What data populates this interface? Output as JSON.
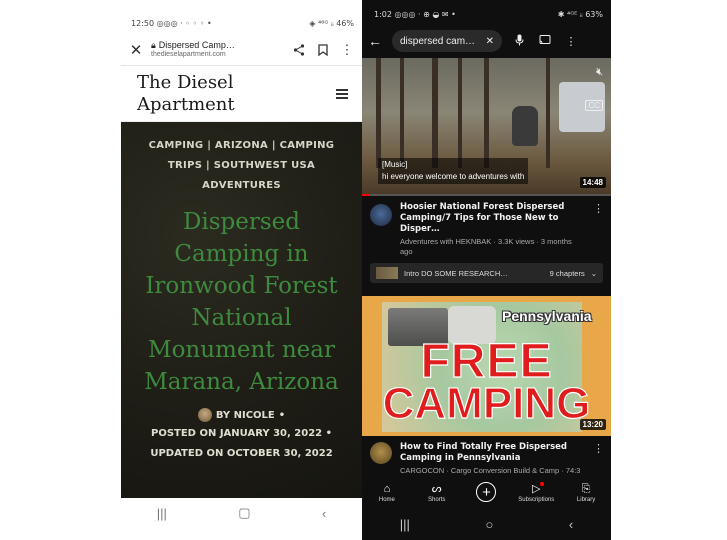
{
  "left_phone": {
    "status": {
      "time": "12:50",
      "icons": "◎◎◎ · ◦ ◦ ◦  •",
      "right": "◈ ⁴⁶ᴳ ᵢᵢ 46%"
    },
    "urlbar": {
      "title": "Dispersed Camp…",
      "url": "thedieselapartment.com"
    },
    "site": {
      "title": "The Diesel Apartment"
    },
    "post": {
      "categories": "CAMPING | ARIZONA | CAMPING TRIPS | SOUTHWEST USA ADVENTURES",
      "title": "Dispersed Camping in Ironwood Forest National Monument near Marana, Arizona",
      "author": "BY NICOLE",
      "sep": "•",
      "posted": "POSTED ON JANUARY 30, 2022",
      "updated": "UPDATED ON OCTOBER 30, 2022"
    },
    "nav": {
      "recents": "|||",
      "home": "▢",
      "back": "‹"
    }
  },
  "right_phone": {
    "status": {
      "time": "1:02",
      "icons": "◎◎◎ · ⊕ ◒ ✉ •",
      "right": "✱ ⁴ᴳᴱ ᵢᵢ 63%"
    },
    "search": {
      "query": "dispersed cam…"
    },
    "video1": {
      "captions_line1": "[Music]",
      "captions_line2": "hi everyone welcome to adventures with",
      "duration": "14:48",
      "title": "Hoosier National Forest Dispersed Camping/7 Tips for Those New to Disper…",
      "subtitle": "Adventures with HEKNBAK · 3.3K views · 3 months ago",
      "chapter_label": "Intro  DO SOME RESEARCH…",
      "chapter_count": "9 chapters"
    },
    "video2": {
      "state_label": "Pennsylvania",
      "big_text_1": "FREE",
      "big_text_2": "CAMPING",
      "duration": "13:20",
      "title": "How to Find Totally Free Dispersed Camping in Pennsylvania",
      "subtitle": "CARGOCON · Cargo Conversion Build & Camp · 74:3"
    },
    "bottom_nav": [
      {
        "label": "Home",
        "icon": "⌂"
      },
      {
        "label": "Shorts",
        "icon": "ᔕ"
      },
      {
        "label": "",
        "icon": "+"
      },
      {
        "label": "Subscriptions",
        "icon": "▷"
      },
      {
        "label": "Library",
        "icon": "⎘"
      }
    ],
    "nav": {
      "recents": "|||",
      "home": "○",
      "back": "‹"
    }
  }
}
